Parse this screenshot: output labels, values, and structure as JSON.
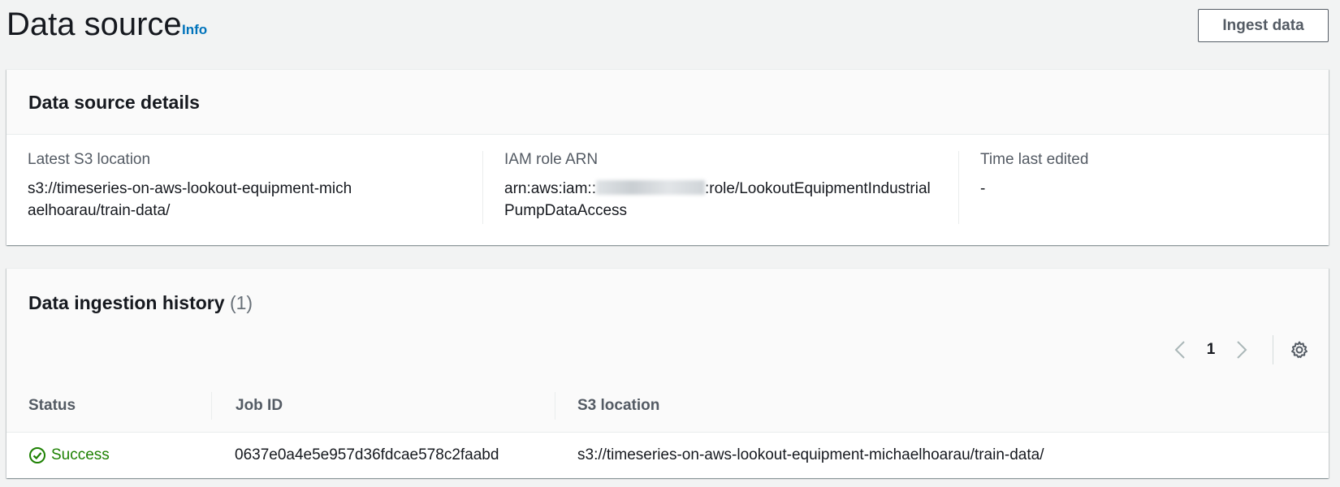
{
  "header": {
    "title": "Data source",
    "info_label": "Info",
    "ingest_button": "Ingest data"
  },
  "details": {
    "title": "Data source details",
    "s3": {
      "label": "Latest S3 location",
      "value": "s3://timeseries-on-aws-lookout-equipment-michaelhoarau/train-data/"
    },
    "iam": {
      "label": "IAM role ARN",
      "value_prefix": "arn:aws:iam::",
      "value_suffix": ":role/LookoutEquipmentIndustrialPumpDataAccess"
    },
    "time": {
      "label": "Time last edited",
      "value": "-"
    }
  },
  "history": {
    "title": "Data ingestion history",
    "count": "(1)",
    "page": "1",
    "columns": [
      "Status",
      "Job ID",
      "S3 location"
    ],
    "rows": [
      {
        "status": "Success",
        "job_id": "0637e0a4e5e957d36fdcae578c2faabd",
        "s3_location": "s3://timeseries-on-aws-lookout-equipment-michaelhoarau/train-data/"
      }
    ]
  },
  "colors": {
    "link": "#0073bb",
    "success": "#1d8102",
    "text": "#16191f",
    "label": "#545b64"
  },
  "icons": [
    "chevron-left-icon",
    "chevron-right-icon",
    "settings-gear-icon",
    "success-check-icon"
  ]
}
